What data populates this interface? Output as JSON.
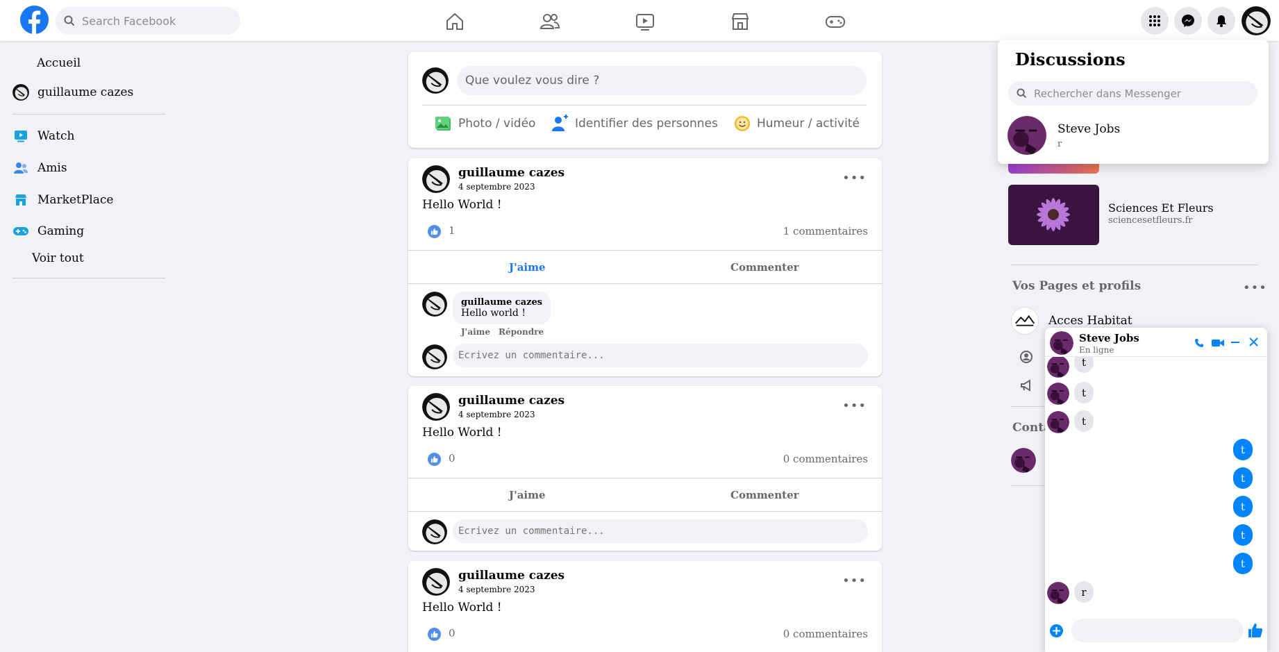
{
  "topbar": {
    "search_placeholder": "Search Facebook",
    "nav_icons": [
      "home-icon",
      "friends-icon",
      "watch-icon",
      "marketplace-icon",
      "gaming-icon"
    ],
    "right_icons": [
      "menu-grid-icon",
      "messenger-icon",
      "notifications-icon"
    ],
    "brand_color": "#1877f2"
  },
  "sidebar": {
    "items": [
      {
        "label": "Accueil",
        "icon": "none"
      },
      {
        "label": "guillaume cazes",
        "icon": "avatar"
      },
      {
        "label": "Watch",
        "icon": "watch-icon"
      },
      {
        "label": "Amis",
        "icon": "friends-icon"
      },
      {
        "label": "MarketPlace",
        "icon": "marketplace-icon"
      },
      {
        "label": "Gaming",
        "icon": "gaming-icon"
      }
    ],
    "see_all": "Voir tout"
  },
  "composer": {
    "placeholder": "Que voulez vous dire ?",
    "actions": [
      {
        "label": "Photo / vidéo",
        "icon": "photo-icon"
      },
      {
        "label": "Identifier des personnes",
        "icon": "tag-people-icon"
      },
      {
        "label": "Humeur / activité",
        "icon": "feeling-icon"
      }
    ]
  },
  "posts": [
    {
      "author": "guillaume cazes",
      "date": "4 septembre 2023",
      "text": "Hello World !",
      "likes": "1",
      "comments_label": "1 commentaires",
      "like_label": "J'aime",
      "comment_label": "Commenter",
      "liked": true,
      "comments": [
        {
          "author": "guillaume cazes",
          "text": "Hello world !",
          "like": "J'aime",
          "reply": "Répondre"
        }
      ],
      "comment_placeholder": "Ecrivez un commentaire..."
    },
    {
      "author": "guillaume cazes",
      "date": "4 septembre 2023",
      "text": "Hello World !",
      "likes": "0",
      "comments_label": "0 commentaires",
      "like_label": "J'aime",
      "comment_label": "Commenter",
      "liked": false,
      "comment_placeholder": "Ecrivez un commentaire..."
    },
    {
      "author": "guillaume cazes",
      "date": "4 septembre 2023",
      "text": "Hello World !",
      "likes": "0",
      "comments_label": "0 commentaires"
    }
  ],
  "right": {
    "sponsored": [
      {
        "title": "Sciences Et Fleurs",
        "url": "sciencesetfleurs.fr"
      }
    ],
    "pages_title": "Vos Pages et profils",
    "pages": [
      {
        "name": "Acces Habitat"
      }
    ],
    "contacts_title_partial": "Conta"
  },
  "discussions": {
    "title": "Discussions",
    "search_placeholder": "Rechercher dans Messenger",
    "items": [
      {
        "name": "Steve Jobs",
        "last_message": "r"
      }
    ]
  },
  "chat": {
    "name": "Steve Jobs",
    "status": "En ligne",
    "messages": [
      {
        "from": "them",
        "text": "t"
      },
      {
        "from": "them",
        "text": "t"
      },
      {
        "from": "them",
        "text": "t"
      },
      {
        "from": "me",
        "text": "t"
      },
      {
        "from": "me",
        "text": "t"
      },
      {
        "from": "me",
        "text": "t"
      },
      {
        "from": "me",
        "text": "t"
      },
      {
        "from": "me",
        "text": "t"
      },
      {
        "from": "them",
        "text": "r"
      }
    ]
  }
}
